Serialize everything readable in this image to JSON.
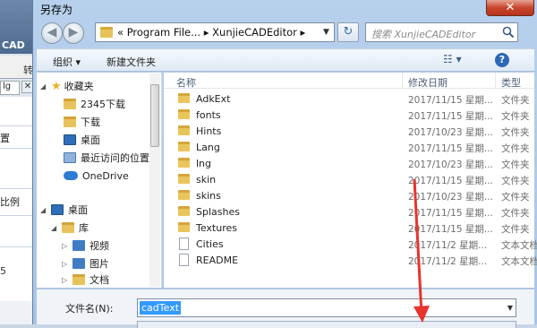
{
  "background_app": {
    "cad_label": "CAD",
    "zhuan_label": "转",
    "tab_label": "lg",
    "tab_close": "✕",
    "set_label": "置",
    "ratio_label": "比例",
    "five_label": "5"
  },
  "dialog": {
    "title": "另存为",
    "close_symbol": "✕"
  },
  "nav": {
    "back_symbol": "◀",
    "forward_symbol": "▶",
    "address": "« Program File... ▸ XunjieCADEditor ▸",
    "address_dropdown": "▼",
    "refresh_symbol": "↻",
    "search_placeholder": "搜索 XunjieCADEditor"
  },
  "toolbar": {
    "organize_label": "组织 ▾",
    "new_folder_label": "新建文件夹",
    "view_symbol": "☷ ▾",
    "help_symbol": "?"
  },
  "sidebar": {
    "favorites": "收藏夹",
    "items": [
      {
        "label": "2345下载"
      },
      {
        "label": "下载"
      },
      {
        "label": "桌面"
      },
      {
        "label": "最近访问的位置"
      },
      {
        "label": "OneDrive"
      },
      {
        "label": "桌面"
      },
      {
        "label": "库"
      },
      {
        "label": "视频"
      },
      {
        "label": "图片"
      },
      {
        "label": "文档"
      }
    ]
  },
  "file_list": {
    "columns": {
      "name": "名称",
      "date": "修改日期",
      "type": "类型"
    },
    "rows": [
      {
        "name": "AdkExt",
        "date": "2017/11/15 星期...",
        "type": "文件夹",
        "kind": "folder"
      },
      {
        "name": "fonts",
        "date": "2017/11/15 星期...",
        "type": "文件夹",
        "kind": "folder"
      },
      {
        "name": "Hints",
        "date": "2017/10/23 星期...",
        "type": "文件夹",
        "kind": "folder"
      },
      {
        "name": "Lang",
        "date": "2017/11/15 星期...",
        "type": "文件夹",
        "kind": "folder"
      },
      {
        "name": "lng",
        "date": "2017/10/23 星期...",
        "type": "文件夹",
        "kind": "folder"
      },
      {
        "name": "skin",
        "date": "2017/11/15 星期...",
        "type": "文件夹",
        "kind": "folder"
      },
      {
        "name": "skins",
        "date": "2017/10/23 星期...",
        "type": "文件夹",
        "kind": "folder"
      },
      {
        "name": "Splashes",
        "date": "2017/11/15 星期...",
        "type": "文件夹",
        "kind": "folder"
      },
      {
        "name": "Textures",
        "date": "2017/11/15 星期...",
        "type": "文件夹",
        "kind": "folder"
      },
      {
        "name": "Cities",
        "date": "2017/11/2 星期...",
        "type": "文本文档",
        "kind": "doc"
      },
      {
        "name": "README",
        "date": "2017/11/2 星期...",
        "type": "文本文档",
        "kind": "doc"
      }
    ]
  },
  "save_form": {
    "filename_label": "文件名(N):",
    "filename_value": "cadText",
    "dropdown_symbol": "▼"
  },
  "colors": {
    "selection": "#3399ff",
    "annotation_arrow": "#e8332d",
    "title_bar": "#b7d0ec"
  }
}
